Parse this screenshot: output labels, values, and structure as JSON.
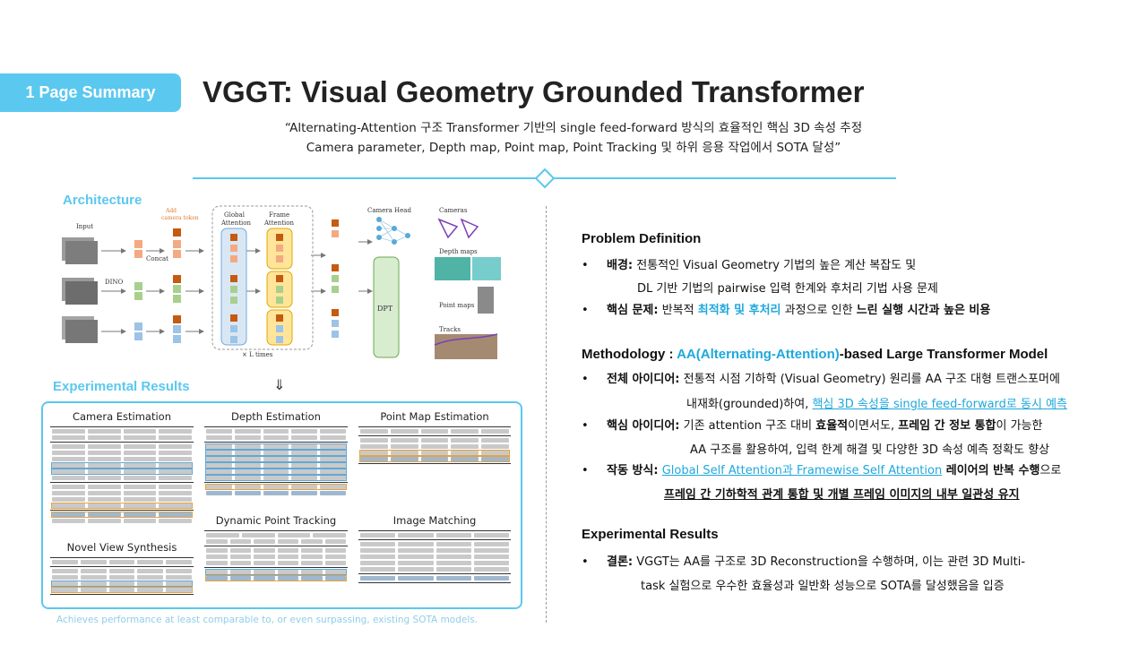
{
  "header": {
    "tag": "1 Page Summary",
    "title": "VGGT: Visual Geometry Grounded Transformer",
    "quote_line1": "“Alternating-Attention 구조 Transformer 기반의 single feed-forward 방식의 효율적인 핵심 3D 속성 추정",
    "quote_line2": "Camera parameter, Depth map, Point map, Point Tracking 및 하위 응용 작업에서 SOTA 달성”"
  },
  "left": {
    "architecture_title": "Architecture",
    "arch": {
      "input": "Input",
      "dino": "DINO",
      "concat": "Concat",
      "add_camera_token": "Add\ncamera token",
      "global_attention": "Global\nAttention",
      "frame_attention": "Frame\nAttention",
      "times": "× L times",
      "camera_head": "Camera Head",
      "dpt": "DPT",
      "cameras": "Cameras",
      "depth_maps": "Depth maps",
      "point_maps": "Point maps",
      "tracks": "Tracks"
    },
    "down_arrow": "⇓",
    "experimental_title": "Experimental Results",
    "panels": {
      "camera": "Camera Estimation",
      "depth": "Depth Estimation",
      "pointmap": "Point Map Estimation",
      "tracking": "Dynamic Point Tracking",
      "matching": "Image Matching",
      "nvs": "Novel View Synthesis"
    },
    "footnote": "Achieves performance at least comparable to, or even surpassing, existing SOTA models."
  },
  "right": {
    "problem": {
      "heading": "Problem Definition",
      "b1_key": "배경:",
      "b1_text": " 전통적인 Visual Geometry 기법의 높은 계산 복잡도 및",
      "b1_cont": "DL 기반 기법의 pairwise 입력 한계와 후처리 기법 사용 문제",
      "b2_key": "핵심 문제:",
      "b2_t1": " 반복적 ",
      "b2_hl": "최적화 및 후처리",
      "b2_t2": " 과정으로 인한 ",
      "b2_bold": "느린 실행 시간과 높은 비용"
    },
    "method": {
      "heading_pre": "Methodology : ",
      "heading_hl": "AA(Alternating-Attention)",
      "heading_post": "-based Large Transformer Model",
      "b1_key": "전체 아이디어:",
      "b1_text": " 전통적 시점 기하학 (Visual Geometry) 원리를 AA 구조 대형 트랜스포머에",
      "b1_cont_pre": "내재화(grounded)하여, ",
      "b1_cont_hl": "핵심 3D 속성을 single feed-forward로 동시 예측",
      "b2_key": "핵심 아이디어:",
      "b2_t1": " 기존 attention 구조 대비 ",
      "b2_b1": "효율적",
      "b2_t2": "이면서도, ",
      "b2_b2": "프레임 간 정보 통합",
      "b2_t3": "이 가능한",
      "b2_cont": "AA 구조를 활용하여, 입력 한계 해결 및 다양한 3D 속성 예측 정확도 향상",
      "b3_key": "작동 방식:",
      "b3_hl": "Global Self Attention과 Framewise Self Attention",
      "b3_bold": " 레이어의 반복 수행",
      "b3_t": "으로",
      "b3_cont": "프레임 간 기하학적 관계 통합 및 개별 프레임 이미지의 내부 일관성 유지"
    },
    "results": {
      "heading": "Experimental Results",
      "b1_key": "결론:",
      "b1_text": " VGGT는 AA를 구조로 3D Reconstruction을 수행하며, 이는 관련 3D Multi-",
      "b1_cont": "task 실험으로 우수한 효율성과 일반화 성능으로 SOTA를 달성했음을 입증"
    },
    "bullet": "•"
  }
}
